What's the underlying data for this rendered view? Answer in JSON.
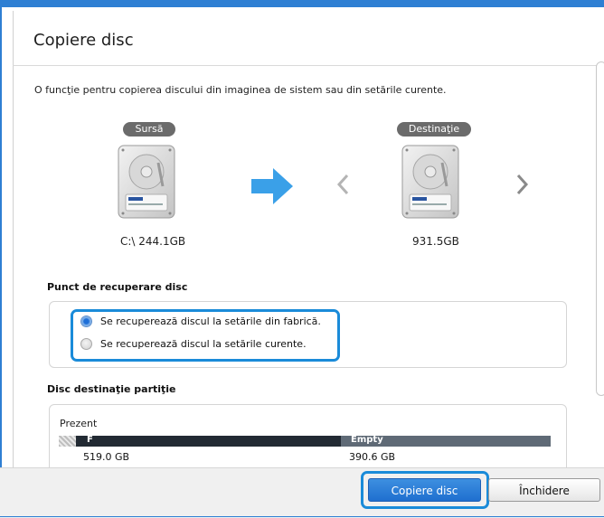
{
  "dialog": {
    "title": "Copiere disc",
    "description": "O funcţie pentru copierea discului din imaginea de sistem sau din setările curente."
  },
  "source": {
    "badge": "Sursă",
    "caption": "C:\\ 244.1GB",
    "icon": "hard-drive-icon"
  },
  "destination": {
    "badge": "Destinaţie",
    "caption": "931.5GB",
    "icon": "hard-drive-icon"
  },
  "recovery": {
    "title": "Punct de recuperare disc",
    "options": [
      {
        "label": "Se recuperează discul la setările din fabrică.",
        "selected": true
      },
      {
        "label": "Se recuperează discul la setările curente.",
        "selected": false
      }
    ]
  },
  "partition": {
    "title": "Disc destinaţie partiţie",
    "row_label": "Prezent",
    "segments": [
      {
        "label": "F",
        "size": "519.0 GB",
        "color": "#222a33"
      },
      {
        "label": "Empty",
        "size": "390.6 GB",
        "color": "#5f6a76"
      }
    ]
  },
  "footer": {
    "primary_button": "Copiere disc",
    "secondary_button": "Închidere"
  },
  "colors": {
    "accent": "#1a8bd9",
    "arrow": "#3aa0e8",
    "titlebar": "#2e7fd3"
  }
}
